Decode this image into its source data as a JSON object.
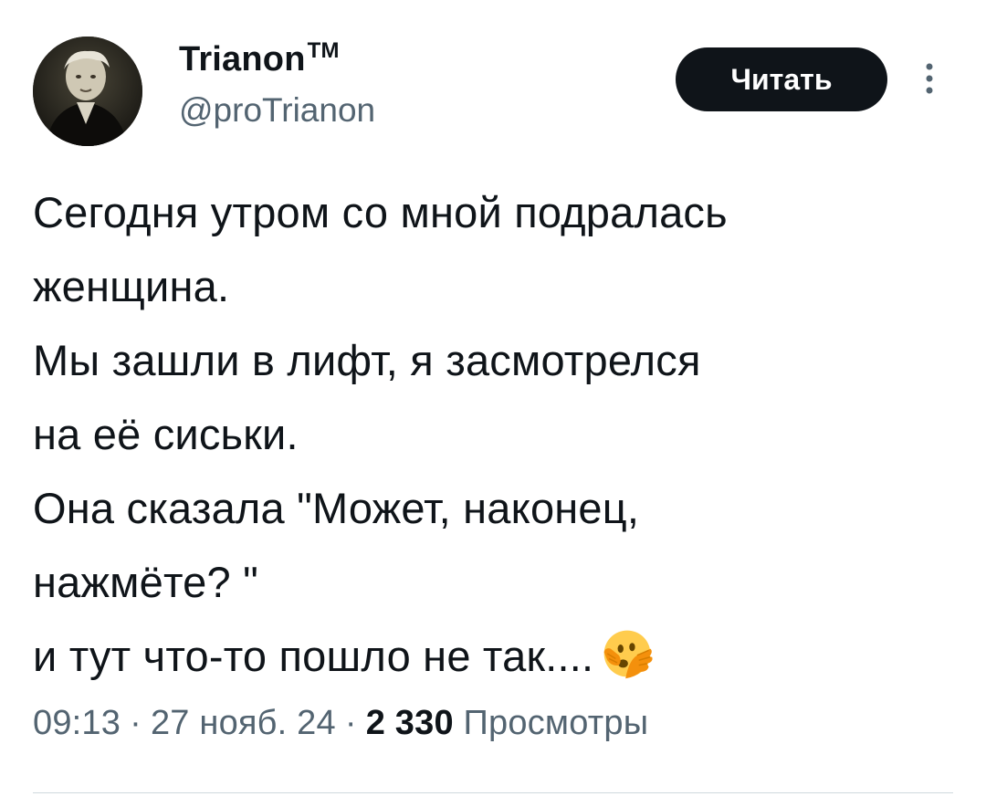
{
  "author": {
    "display_name": "Trianon",
    "trademark": "TM",
    "handle": "@proTrianon",
    "avatar_icon": "portrait-avatar"
  },
  "actions": {
    "follow_label": "Читать",
    "more_icon": "vertical-ellipsis-icon"
  },
  "tweet": {
    "lines": [
      "Сегодня утром со мной подралась",
      "женщина.",
      "Мы зашли в лифт, я засмотрелся",
      "на её сиськи.",
      "Она сказала \"Может, наконец,",
      "нажмёте? \"",
      "и тут что-то пошло не так...."
    ],
    "emoji": "face-with-open-eyes-and-hand-over-mouth"
  },
  "meta": {
    "time": "09:13",
    "separator": "·",
    "date": "27 нояб. 24",
    "views_count": "2 330",
    "views_label": "Просмотры"
  },
  "colors": {
    "text_primary": "#0f1419",
    "text_secondary": "#536471",
    "button_bg": "#0f1419",
    "divider": "#cfd9de"
  }
}
